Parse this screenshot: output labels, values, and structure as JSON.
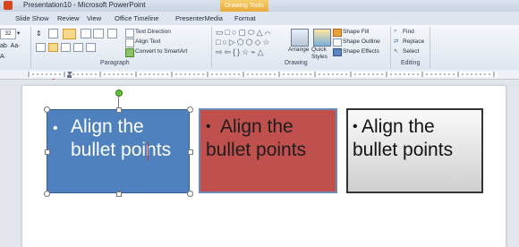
{
  "window": {
    "title": "Presentation10 - Microsoft PowerPoint"
  },
  "contextual_tab": "Drawing Tools",
  "tabs": [
    "Slide Show",
    "Review",
    "View",
    "Office Timeline",
    "PresenterMedia",
    "Format"
  ],
  "ribbon": {
    "font_size": "32",
    "paragraph": {
      "text_direction": "Text Direction",
      "align_text": "Align Text",
      "convert_smartart": "Convert to SmartArt",
      "group_label": "Paragraph"
    },
    "drawing": {
      "arrange": "Arrange",
      "quick_styles": "Quick Styles",
      "shape_fill": "Shape Fill",
      "shape_outline": "Shape Outline",
      "shape_effects": "Shape Effects",
      "group_label": "Drawing"
    },
    "editing": {
      "find": "Find",
      "replace": "Replace",
      "select": "Select",
      "group_label": "Editing"
    }
  },
  "slide": {
    "boxes": [
      {
        "bullet": "•",
        "text": "Align the bullet points",
        "fill": "#4e81bd"
      },
      {
        "bullet": "•",
        "text": "Align the bullet points",
        "fill": "#c0504d"
      },
      {
        "bullet": "•",
        "text": "Align the bullet points",
        "fill": "#d9d9d9"
      }
    ]
  },
  "colors": {
    "accent_tab": "#e8a93a",
    "arrow": "#e02020"
  }
}
